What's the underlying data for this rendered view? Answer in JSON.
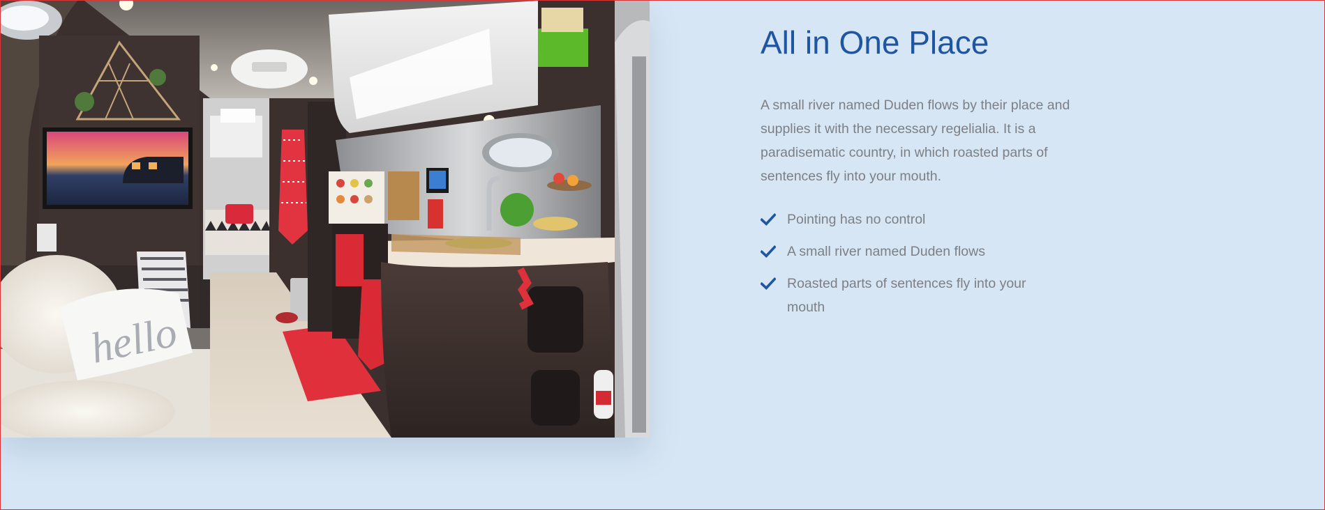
{
  "section": {
    "heading": "All in One Place",
    "paragraph": "A small river named Duden flows by their place and supplies it with the necessary regelialia. It is a paradisematic country, in which roasted parts of sentences fly into your mouth.",
    "features": [
      "Pointing has no control",
      "A small river named Duden flows",
      "Roasted parts of sentences fly into your mouth"
    ]
  },
  "image": {
    "subject": "camper-trailer-interior-photo",
    "pillow_text": "hello"
  },
  "colors": {
    "accent": "#1f55a1",
    "background": "#d7e6f4",
    "body_text": "#7c7f85"
  },
  "icons": {
    "feature_marker": "check-icon"
  }
}
